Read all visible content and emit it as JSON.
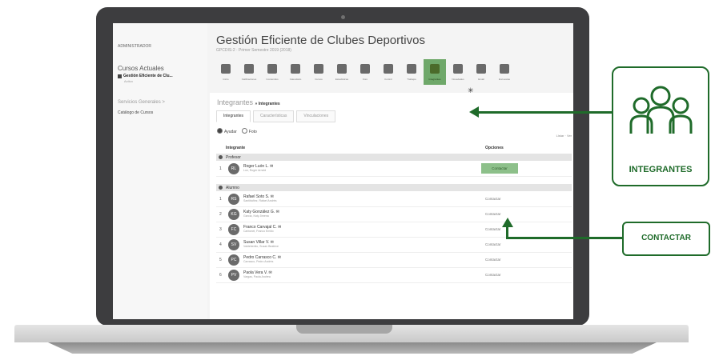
{
  "sidebar": {
    "admin": "ADMINISTRADOR",
    "cursos_actuales": "Cursos Actuales",
    "curso": "Gestión Eficiente de Clu...",
    "curso_sub": "Activo",
    "servicios": "Servicios Generales >",
    "catalogo": "Catálogo de Cursos"
  },
  "header": {
    "title": "Gestión Eficiente de Clubes Deportivos",
    "subtitle": "GPCDIS-2 · Primer Semestre 2019 (2018)"
  },
  "toolbar": {
    "items": [
      {
        "label": "Inicio",
        "icon": "edit-icon"
      },
      {
        "label": "Calificaciones",
        "icon": "users-icon"
      },
      {
        "label": "Contenidos",
        "icon": "document-icon"
      },
      {
        "label": "Calendario",
        "icon": "calendar-icon"
      },
      {
        "label": "Cursos",
        "icon": "puzzle-icon"
      },
      {
        "label": "Estadísticas",
        "icon": "chart-icon"
      },
      {
        "label": "Foro",
        "icon": "chat-icon"
      },
      {
        "label": "Control",
        "icon": "person-icon"
      },
      {
        "label": "Trabajos",
        "icon": "image-icon"
      },
      {
        "label": "Integrantes",
        "icon": "group-icon"
      },
      {
        "label": "Novedades",
        "icon": "share-icon"
      },
      {
        "label": "Email",
        "icon": "mail-icon"
      },
      {
        "label": "Encuestas",
        "icon": "gear-icon"
      }
    ]
  },
  "panel": {
    "breadcrumb_main": "Integrantes",
    "breadcrumb_sub": "» Integrantes",
    "tabs": [
      "Integrantes",
      "Características",
      "Vinculaciones"
    ],
    "option_ayudar": "Ayudar",
    "option_foto": "Foto",
    "tools": "Listar · Ver",
    "col_integrante": "Integrante",
    "col_opciones": "Opciones",
    "sect_profesor": "Profesor",
    "sect_alumno": "Alumno",
    "contact_label": "Contactar",
    "profesor": [
      {
        "num": "1",
        "initials": "RL",
        "name": "Roger Luón L. ✉",
        "email": "Luo, Roger Arnold"
      }
    ],
    "alumnos": [
      {
        "num": "1",
        "initials": "RS",
        "name": "Rafael Soto S. ✉",
        "email": "Santibáñez, Rafael Andrés"
      },
      {
        "num": "2",
        "initials": "KG",
        "name": "Katy González G. ✉",
        "email": "García, Katy Jimena"
      },
      {
        "num": "3",
        "initials": "FC",
        "name": "Franco Carvajal C. ✉",
        "email": "Carbonel, Franco Emilio"
      },
      {
        "num": "4",
        "initials": "SV",
        "name": "Susan Villar V. ✉",
        "email": "Valdebenito, Susan Beatrice"
      },
      {
        "num": "5",
        "initials": "PC",
        "name": "Pedro Carrasco C. ✉",
        "email": "Carrasco, Pedro Andrés"
      },
      {
        "num": "6",
        "initials": "PV",
        "name": "Paola Vera V. ✉",
        "email": "Vargas, Paola Andrea"
      }
    ]
  },
  "callouts": {
    "integrantes": "INTEGRANTES",
    "contactar": "CONTACTAR"
  },
  "colors": {
    "accent_green": "#1f6b2a",
    "highlight_green": "#8dc08a"
  }
}
